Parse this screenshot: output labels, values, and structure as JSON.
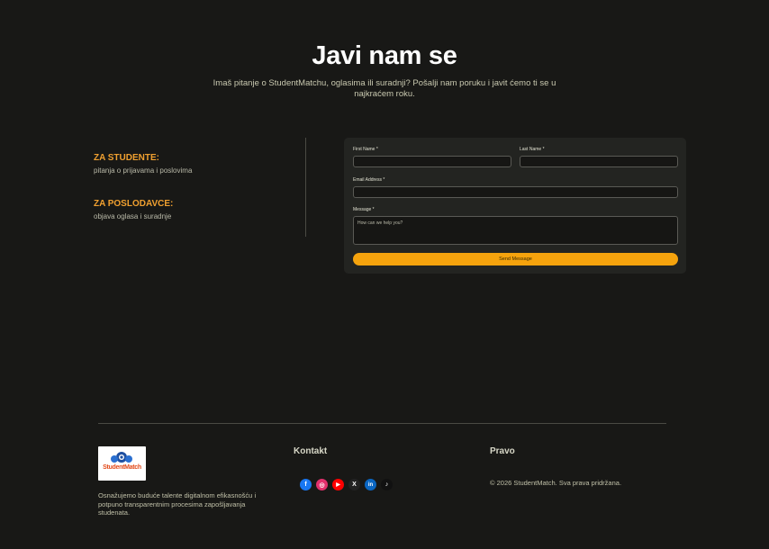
{
  "header": {
    "title": "Javi nam se",
    "subtitle": "Imaš pitanje o StudentMatchu, oglasima ili suradnji? Pošalji nam poruku i javit ćemo ti se u najkraćem roku."
  },
  "info": {
    "students_heading": "ZA STUDENTE:",
    "students_text": "pitanja o prijavama i poslovima",
    "employers_heading": "ZA POSLODAVCE:",
    "employers_text": "objava oglasa i suradnje"
  },
  "form": {
    "first_name_label": "First Name *",
    "last_name_label": "Last Name *",
    "email_label": "Email Address *",
    "message_label": "Message *",
    "message_placeholder": "How can we help you?",
    "first_name_value": "",
    "last_name_value": "",
    "email_value": "",
    "send_label": "Send Message"
  },
  "footer": {
    "logo_text": "StudentMatch",
    "description": "Osnažujemo buduće talente digitalnom efikasnošću i potpuno transparentnim procesima zapošljavanja studenata.",
    "contact_heading": "Kontakt",
    "legal_heading": "Pravo",
    "copyright": "© 2026 StudentMatch. Sva prava pridržana.",
    "social": [
      {
        "name": "facebook-icon",
        "glyph": "f",
        "color": "#1877f2"
      },
      {
        "name": "instagram-icon",
        "glyph": "◎",
        "color": "#e1306c"
      },
      {
        "name": "youtube-icon",
        "glyph": "▶",
        "color": "#ff0000"
      },
      {
        "name": "x-icon",
        "glyph": "𝕏",
        "color": "#222222"
      },
      {
        "name": "linkedin-icon",
        "glyph": "in",
        "color": "#0a66c2"
      },
      {
        "name": "tiktok-icon",
        "glyph": "♪",
        "color": "#111111"
      }
    ]
  },
  "colors": {
    "accent": "#f5a30d",
    "background": "#181816",
    "heading_orange": "#f0a030"
  }
}
